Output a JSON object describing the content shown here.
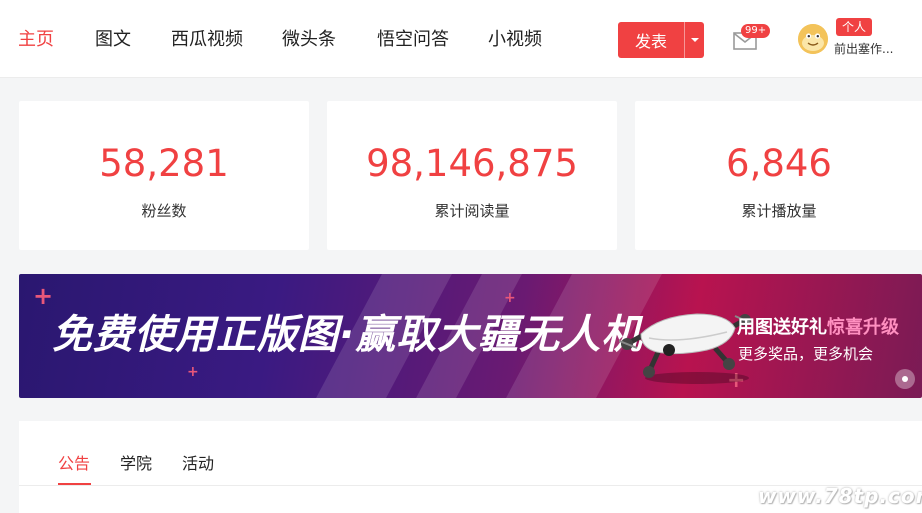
{
  "nav": {
    "items": [
      {
        "label": "主页",
        "active": true
      },
      {
        "label": "图文",
        "active": false
      },
      {
        "label": "西瓜视频",
        "active": false
      },
      {
        "label": "微头条",
        "active": false
      },
      {
        "label": "悟空问答",
        "active": false
      },
      {
        "label": "小视频",
        "active": false
      }
    ],
    "publish_label": "发表",
    "mail_badge": "99+",
    "user_tag": "个人",
    "user_name": "前出塞作..."
  },
  "stats": [
    {
      "value": "58,281",
      "label": "粉丝数"
    },
    {
      "value": "98,146,875",
      "label": "累计阅读量"
    },
    {
      "value": "6,846",
      "label": "累计播放量"
    }
  ],
  "banner": {
    "headline": "免费使用正版图·赢取大疆无人机",
    "side_line1_prefix": "用图送好礼",
    "side_line1_highlight": "惊喜升级",
    "side_line2": "更多奖品，更多机会"
  },
  "tabs": [
    {
      "label": "公告",
      "active": true
    },
    {
      "label": "学院",
      "active": false
    },
    {
      "label": "活动",
      "active": false
    }
  ],
  "watermark": "www.78tp.com",
  "colors": {
    "accent": "#f04142",
    "text": "#222222",
    "page_bg": "#f4f5f6"
  }
}
